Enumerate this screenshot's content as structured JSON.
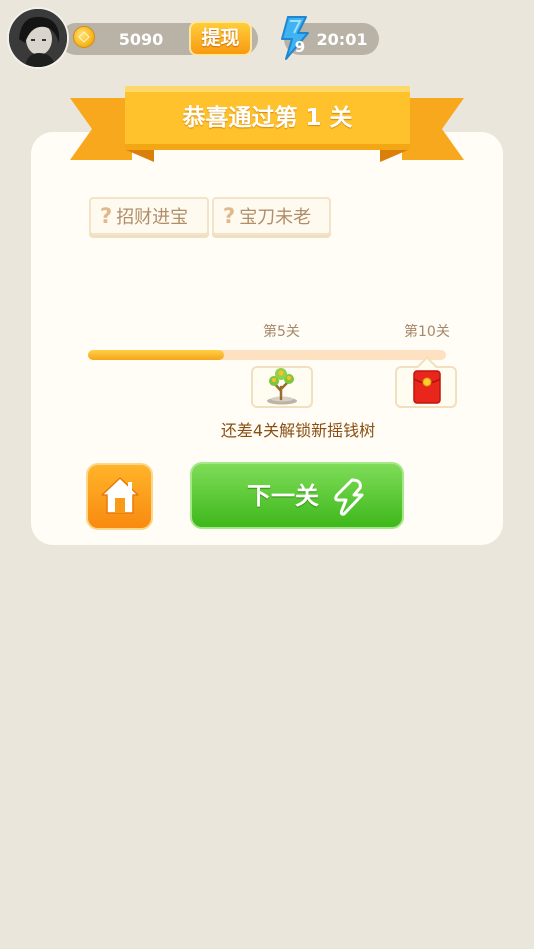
{
  "header": {
    "coins": "5090",
    "withdraw_label": "提现",
    "energy_count": "9",
    "energy_timer": "20:01"
  },
  "result": {
    "title": "恭喜通过第 1 关"
  },
  "hints": [
    {
      "mark": "?",
      "label": "招财进宝"
    },
    {
      "mark": "?",
      "label": "宝刀未老"
    }
  ],
  "progress": {
    "milestones": [
      {
        "label": "第5关",
        "reward": "money-tree-icon"
      },
      {
        "label": "第10关",
        "reward": "red-envelope-icon"
      }
    ],
    "fill_fraction": 0.38,
    "message": "还差4关解锁新摇钱树"
  },
  "actions": {
    "next_label": "下一关"
  },
  "colors": {
    "background": "#ebe6dc",
    "card": "#fffdf6",
    "ribbon": "#ffbf2a",
    "progress_fill": "#f7a51c",
    "next_button": "#4cc427",
    "home_button": "#f99a18"
  }
}
